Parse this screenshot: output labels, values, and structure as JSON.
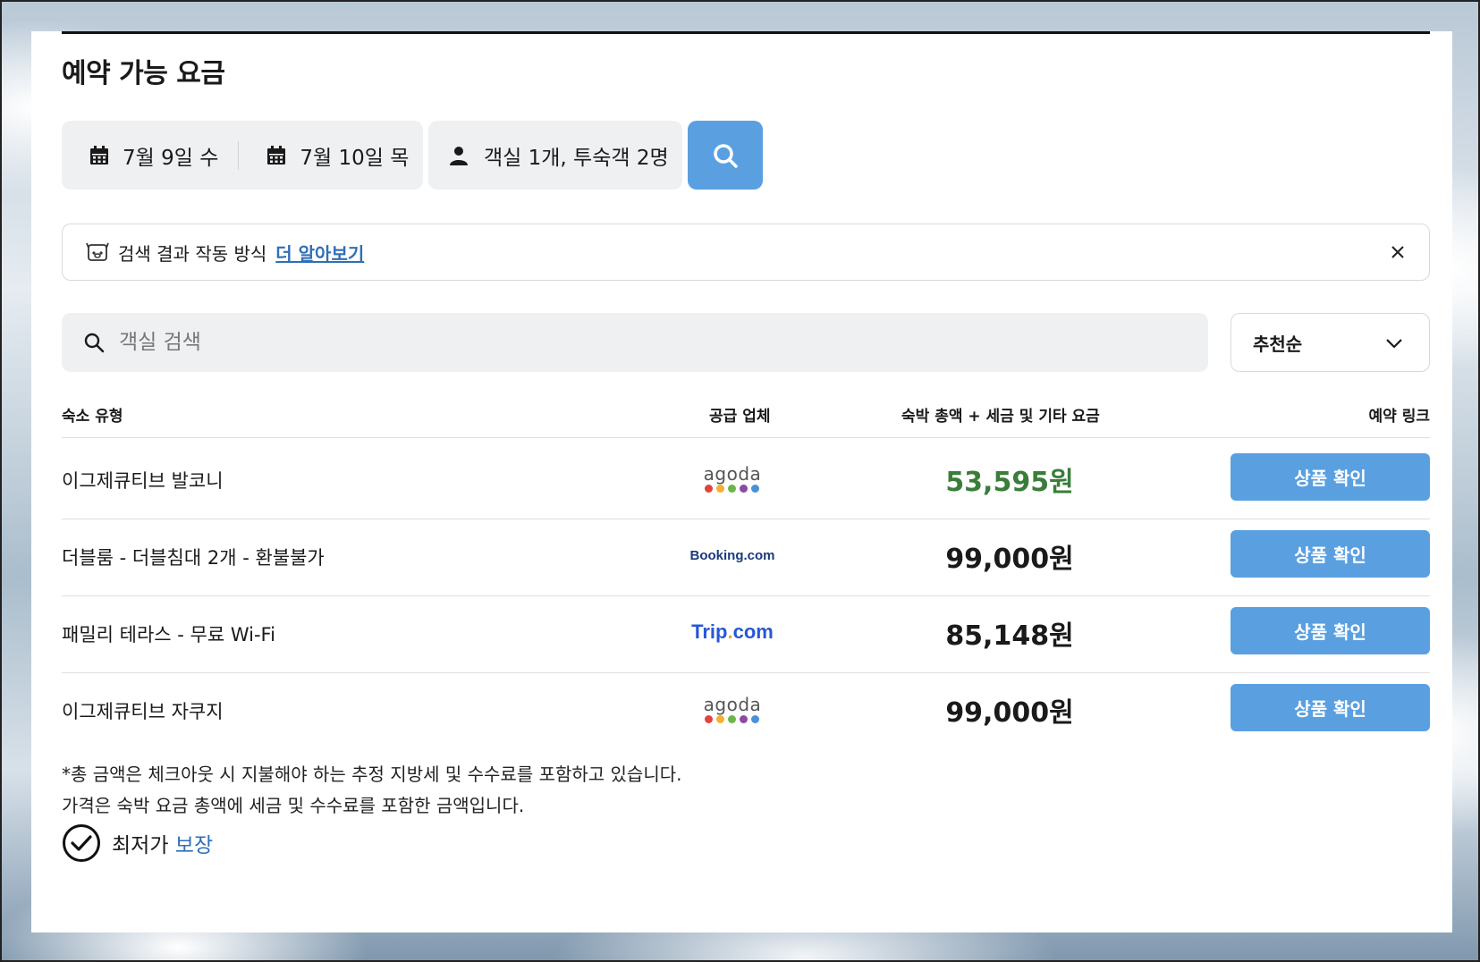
{
  "page": {
    "title": "예약 가능 요금"
  },
  "search": {
    "checkin": "7월 9일 수",
    "checkout": "7월 10일 목",
    "guests": "객실 1개, 투숙객 2명"
  },
  "info_banner": {
    "text": "검색 결과 작동 방식",
    "link": "더 알아보기"
  },
  "room_search": {
    "placeholder": "객실 검색"
  },
  "sort": {
    "selected": "추천순"
  },
  "table": {
    "headers": {
      "type": "숙소 유형",
      "vendor": "공급 업체",
      "price": "숙박 총액 + 세금 및 기타 요금",
      "link": "예약 링크"
    },
    "rows": [
      {
        "name": "이그제큐티브 발코니",
        "vendor": "agoda",
        "price": "53,595원",
        "cta": "상품 확인"
      },
      {
        "name": "더블룸 - 더블침대 2개 - 환불불가",
        "vendor": "Booking.com",
        "price": "99,000원",
        "cta": "상품 확인"
      },
      {
        "name": "패밀리 테라스 - 무료 Wi-Fi",
        "vendor": "Trip.com",
        "price": "85,148원",
        "cta": "상품 확인"
      },
      {
        "name": "이그제큐티브 자쿠지",
        "vendor": "agoda",
        "price": "99,000원",
        "cta": "상품 확인"
      }
    ]
  },
  "footnotes": {
    "line1": "*총 금액은 체크아웃 시 지불해야 하는 추정 지방세 및 수수료를 포함하고 있습니다.",
    "line2": "가격은 숙박 요금 총액에 세금 및 수수료를 포함한 금액입니다.",
    "guarantee_prefix": "최저가",
    "guarantee_highlight": "보장"
  },
  "colors": {
    "accent": "#5aa0e0",
    "best_price": "#3a7d3a",
    "link": "#2f6fb7"
  },
  "icons": [
    "calendar-icon",
    "person-icon",
    "search-icon",
    "info-robot-icon",
    "close-icon",
    "chevron-down-icon",
    "check-circle-icon"
  ]
}
